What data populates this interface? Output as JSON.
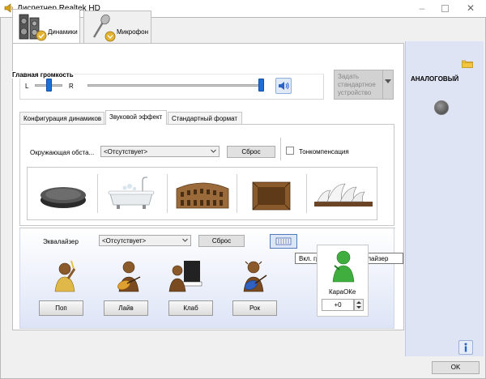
{
  "window": {
    "title": "Диспетчер Realtek HD",
    "minimize_icon": "minimize-icon",
    "maximize_icon": "maximize-icon",
    "close_icon": "close-icon"
  },
  "device_tabs": [
    {
      "label": "Динамики",
      "icon": "speakers-icon",
      "selected": true
    },
    {
      "label": "Микрофон",
      "icon": "microphone-icon",
      "selected": false
    }
  ],
  "volume": {
    "title": "Главная громкость",
    "left_label": "L",
    "right_label": "R",
    "balance_level": 0.5,
    "volume_level": 1.0
  },
  "default_device_button": {
    "label": "Задать стандартное устройство",
    "line1": "Задать",
    "line2": "стандартное",
    "line3": "устройство"
  },
  "inner_tabs": [
    {
      "label": "Конфигурация динамиков",
      "selected": false
    },
    {
      "label": "Звуковой эффект",
      "selected": true
    },
    {
      "label": "Стандартный формат",
      "selected": false
    }
  ],
  "environment": {
    "label": "Окружающая обста...",
    "value": "<Отсутствует>",
    "reset_label": "Сброс",
    "loudness_label": "Тонкомпенсация",
    "loudness_checked": false,
    "presets": [
      "stone-icon",
      "bathtub-icon",
      "colosseum-icon",
      "room-icon",
      "opera-house-icon"
    ]
  },
  "equalizer": {
    "label": "Эквалайзер",
    "value": "<Отсутствует>",
    "reset_label": "Сброс",
    "tooltip": "Вкл. графический эквалайзер",
    "presets": [
      "Поп",
      "Лайв",
      "Клаб",
      "Рок"
    ]
  },
  "karaoke": {
    "label": "КараОКе",
    "value": "+0"
  },
  "right_panel": {
    "label": "АНАЛОГОВЫЙ"
  },
  "ok_label": "OK",
  "colors": {
    "accent": "#1e6ed8",
    "right_panel_bg": "#dfe4f5",
    "karaoke_green": "#3fae3f"
  }
}
